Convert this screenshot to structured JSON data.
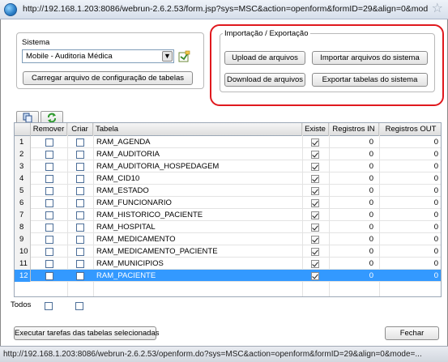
{
  "browser": {
    "url": "http://192.168.1.203:8086/webrun-2.6.2.53/form.jsp?sys=MSC&action=openform&formID=29&align=0&mode=-1&",
    "status_url": "http://192.168.1.203:8086/webrun-2.6.2.53/openform.do?sys=MSC&action=openform&formID=29&align=0&mode=..."
  },
  "sistema": {
    "label": "Sistema",
    "selected": "Mobile - Auditoria Médica",
    "load_config_button": "Carregar arquivo de configuração de tabelas"
  },
  "import_export": {
    "legend": "Importação / Exportação",
    "upload_button": "Upload de arquivos",
    "import_button": "Importar arquivos do sistema",
    "download_button": "Download de arquivos",
    "export_button": "Exportar tabelas do sistema",
    "highlight_color": "#e0191e"
  },
  "grid": {
    "columns": {
      "remover": "Remover",
      "criar": "Criar",
      "tabela": "Tabela",
      "existe": "Existe",
      "registros_in": "Registros IN",
      "registros_out": "Registros OUT"
    },
    "rows": [
      {
        "num": "1",
        "tabela": "RAM_AGENDA",
        "remover": false,
        "criar": false,
        "existe": true,
        "in": "0",
        "out": "0"
      },
      {
        "num": "2",
        "tabela": "RAM_AUDITORIA",
        "remover": false,
        "criar": false,
        "existe": true,
        "in": "0",
        "out": "0"
      },
      {
        "num": "3",
        "tabela": "RAM_AUDITORIA_HOSPEDAGEM",
        "remover": false,
        "criar": false,
        "existe": true,
        "in": "0",
        "out": "0"
      },
      {
        "num": "4",
        "tabela": "RAM_CID10",
        "remover": false,
        "criar": false,
        "existe": true,
        "in": "0",
        "out": "0"
      },
      {
        "num": "5",
        "tabela": "RAM_ESTADO",
        "remover": false,
        "criar": false,
        "existe": true,
        "in": "0",
        "out": "0"
      },
      {
        "num": "6",
        "tabela": "RAM_FUNCIONARIO",
        "remover": false,
        "criar": false,
        "existe": true,
        "in": "0",
        "out": "0"
      },
      {
        "num": "7",
        "tabela": "RAM_HISTORICO_PACIENTE",
        "remover": false,
        "criar": false,
        "existe": true,
        "in": "0",
        "out": "0"
      },
      {
        "num": "8",
        "tabela": "RAM_HOSPITAL",
        "remover": false,
        "criar": false,
        "existe": true,
        "in": "0",
        "out": "0"
      },
      {
        "num": "9",
        "tabela": "RAM_MEDICAMENTO",
        "remover": false,
        "criar": false,
        "existe": true,
        "in": "0",
        "out": "0"
      },
      {
        "num": "10",
        "tabela": "RAM_MEDICAMENTO_PACIENTE",
        "remover": false,
        "criar": false,
        "existe": true,
        "in": "0",
        "out": "0"
      },
      {
        "num": "11",
        "tabela": "RAM_MUNICIPIOS",
        "remover": false,
        "criar": false,
        "existe": true,
        "in": "0",
        "out": "0"
      },
      {
        "num": "12",
        "tabela": "RAM_PACIENTE",
        "remover": false,
        "criar": false,
        "existe": true,
        "in": "0",
        "out": "0",
        "selected": true
      }
    ]
  },
  "footer": {
    "todos_label": "Todos",
    "execute_button": "Executar tarefas das tabelas selecionadas",
    "close_button": "Fechar"
  }
}
